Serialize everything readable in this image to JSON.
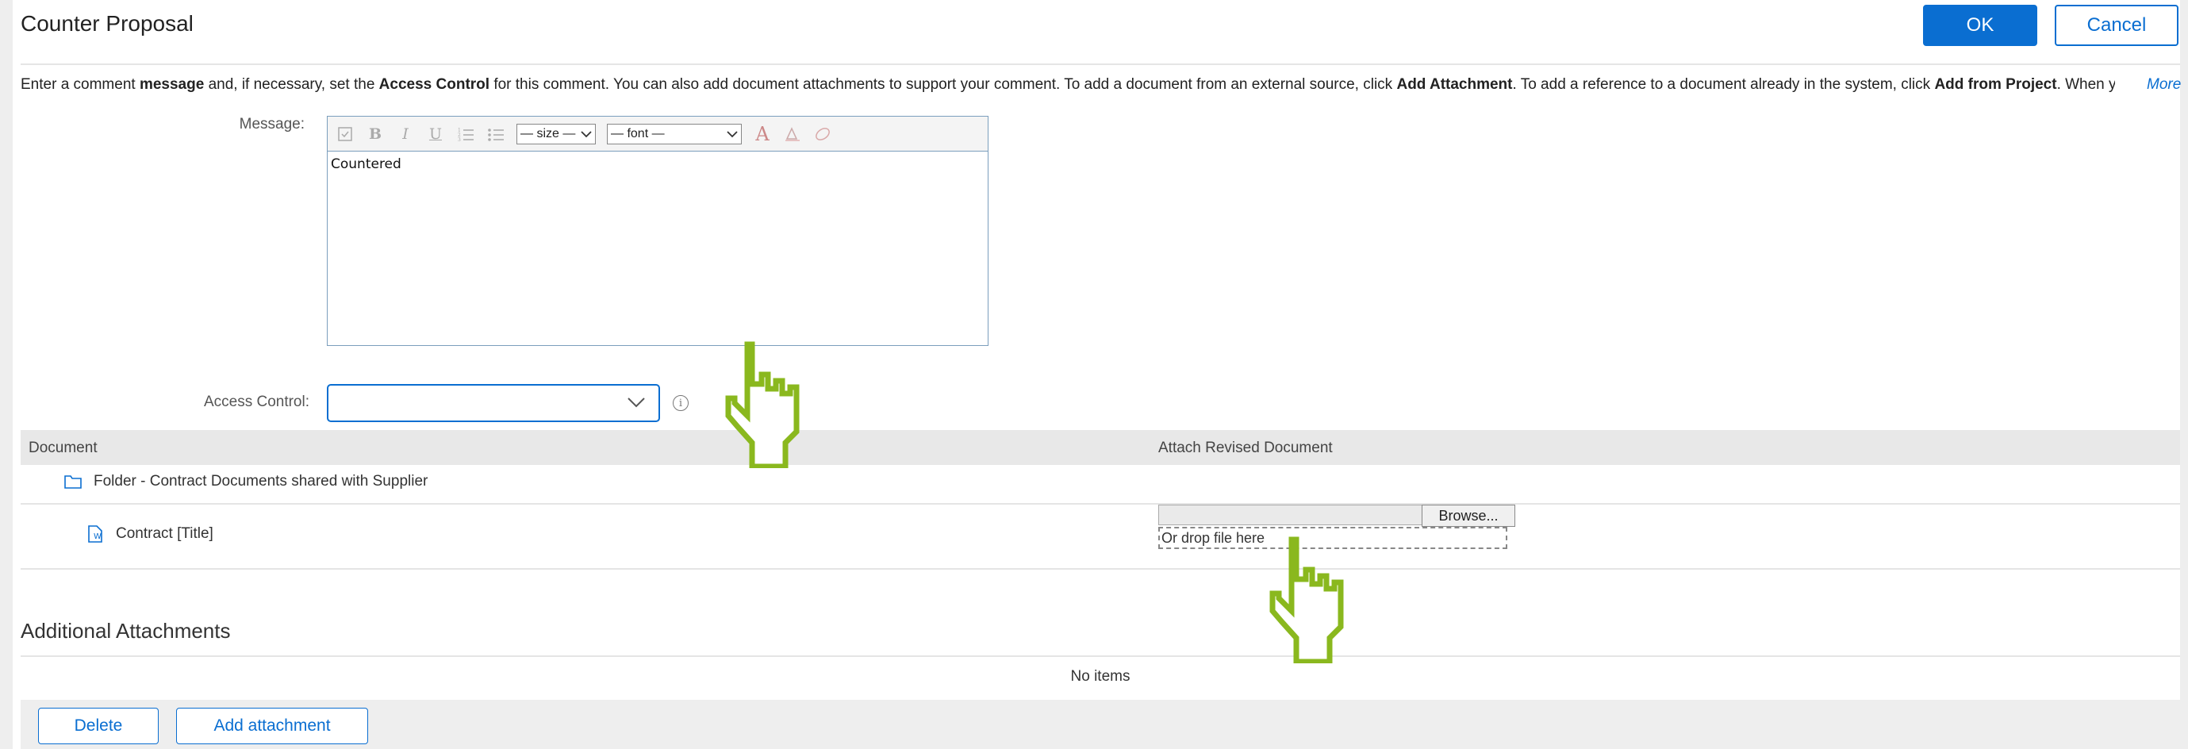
{
  "header": {
    "title": "Counter Proposal",
    "ok_label": "OK",
    "cancel_label": "Cancel"
  },
  "intro": {
    "p1": "Enter a comment ",
    "b1": "message",
    "p2": " and, if necessary, set the ",
    "b2": "Access Control",
    "p3": " for this comment. You can also add document attachments to support your comment. To add a document from an external source, click ",
    "b3": "Add Attachment",
    "p4": ". To add a reference to a document already in the system, click ",
    "b4": "Add from Project",
    "p5": ". When you",
    "more_label": "More"
  },
  "message": {
    "label": "Message:",
    "size_select": "— size —",
    "font_select": "— font —",
    "value": "Countered"
  },
  "access_control": {
    "label": "Access Control:",
    "value": ""
  },
  "documents": {
    "col_document": "Document",
    "col_attach": "Attach Revised Document",
    "folder_label": "Folder - Contract Documents shared with Supplier",
    "doc_label": "Contract [Title]",
    "browse_label": "Browse...",
    "drop_label": "Or drop file here"
  },
  "attachments": {
    "title": "Additional Attachments",
    "empty_text": "No items",
    "delete_label": "Delete",
    "add_label": "Add attachment"
  },
  "colors": {
    "accent": "#0a6ed1",
    "cursor": "#8ab81e"
  }
}
